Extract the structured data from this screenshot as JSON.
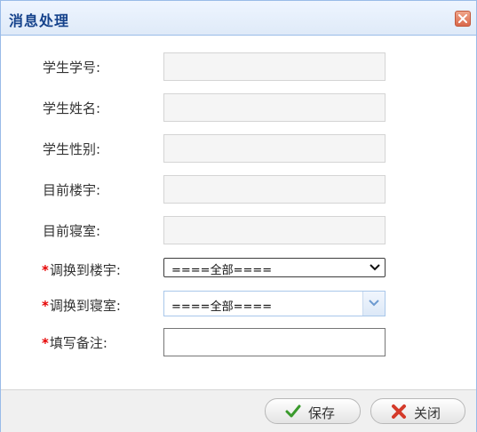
{
  "dialog": {
    "title": "消息处理",
    "close_icon": "close-icon"
  },
  "form": {
    "student_id": {
      "label": "学生学号:",
      "value": ""
    },
    "student_name": {
      "label": "学生姓名:",
      "value": ""
    },
    "student_gender": {
      "label": "学生性别:",
      "value": ""
    },
    "current_building": {
      "label": "目前楼宇:",
      "value": ""
    },
    "current_room": {
      "label": "目前寝室:",
      "value": ""
    },
    "target_building": {
      "required_mark": "*",
      "label": "调换到楼宇:",
      "selected": "====全部===="
    },
    "target_room": {
      "required_mark": "*",
      "label": "调换到寝室:",
      "selected": "====全部===="
    },
    "remark": {
      "required_mark": "*",
      "label": "填写备注:",
      "value": ""
    }
  },
  "footer": {
    "save_label": "保存",
    "close_label": "关闭",
    "save_icon": "check-icon",
    "close_icon": "x-icon"
  },
  "colors": {
    "title_text": "#15428b",
    "border": "#99bbe8",
    "required": "#e60000"
  }
}
